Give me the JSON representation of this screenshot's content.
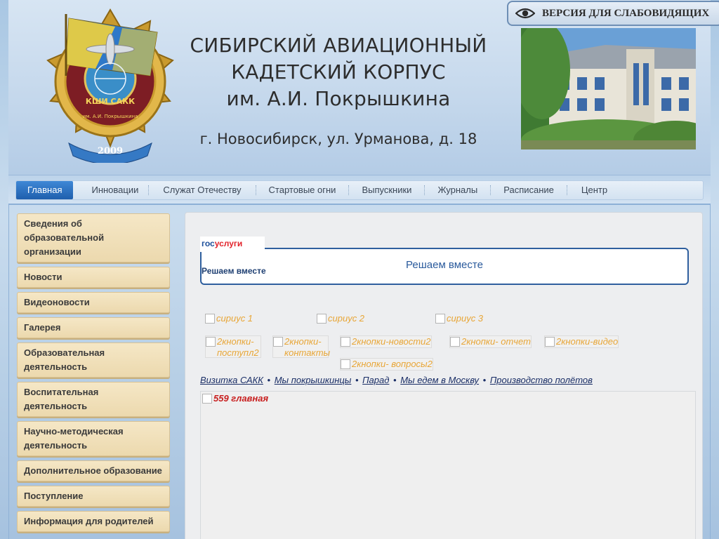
{
  "header": {
    "title_lines": [
      "СИБИРСКИЙ АВИАЦИОННЫЙ",
      "КАДЕТСКИЙ КОРПУС",
      "им. А.И. Покрышкина"
    ],
    "address": "г. Новосибирск, ул. Урманова, д. 18",
    "accessibility_label": "ВЕРСИЯ ДЛЯ СЛАБОВИДЯЩИХ",
    "emblem": {
      "text_top": "КШИ САКК",
      "text_bottom": "им. А.И. Покрышкина",
      "year": "2009"
    }
  },
  "nav": {
    "items": [
      "Главная",
      "Инновации",
      "Служат Отечеству",
      "Стартовые огни",
      "Выпускники",
      "Журналы",
      "Расписание",
      "Центр"
    ]
  },
  "sidebar": {
    "items": [
      "Сведения об образовательной организации",
      "Новости",
      "Видеоновости",
      "Галерея",
      "Образовательная деятельность",
      "Воспитательная деятельность",
      "Научно-методическая деятельность",
      "Дополнительное образование",
      "Поступление",
      "Информация для родителей"
    ]
  },
  "gosuslugi": {
    "brand_part1": "гос",
    "brand_part2": "услуги",
    "tagline": "Решаем вместе",
    "center_text": "Решаем вместе"
  },
  "images": {
    "sirius": [
      "сириус 1",
      "сириус 2",
      "сириус 3"
    ],
    "buttons": [
      "2кнопки-поступл2",
      "2кнопки-контакты",
      "2кнопки-новости2",
      "2кнопки- отчет",
      "2кнопки-видео",
      "2кнопки- вопросы2"
    ],
    "main": "559 главная"
  },
  "links": [
    "Визитка САКК",
    "Мы покрышкинцы",
    "Парад",
    "Мы едем в Москву",
    "Производство полётов"
  ],
  "colors": {
    "accent": "#1f5fad",
    "sidebar_bg": "#ecd9ae",
    "gos_border": "#2f5f9e"
  }
}
